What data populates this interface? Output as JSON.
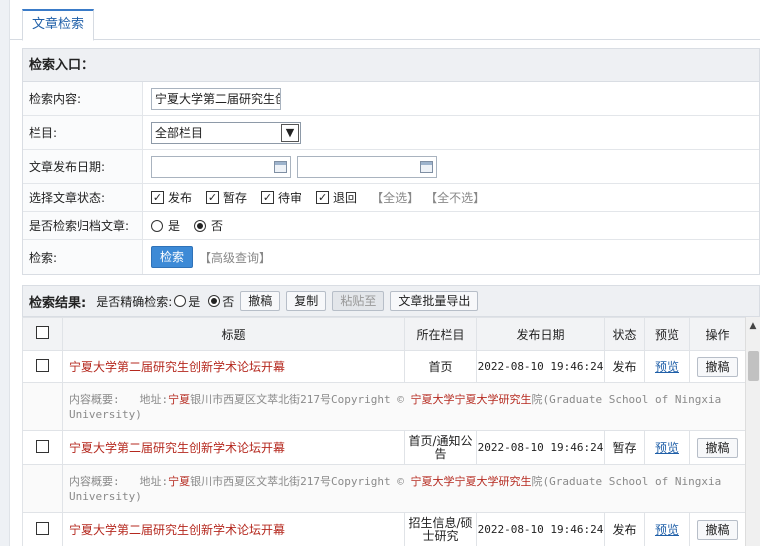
{
  "tab": {
    "label": "文章检索"
  },
  "search": {
    "header": "检索入口：",
    "content_label": "检索内容:",
    "content_value": "宁夏大学第二届研究生创",
    "column_label": "栏目:",
    "column_value": "全部栏目",
    "date_label": "文章发布日期:",
    "status_label": "选择文章状态:",
    "status_options": [
      "发布",
      "暂存",
      "待审",
      "退回"
    ],
    "select_all": "【全选】",
    "select_none": "【全不选】",
    "archive_label": "是否检索归档文章:",
    "archive_yes": "是",
    "archive_no": "否",
    "search_label": "检索:",
    "search_button": "检索",
    "advanced_link": "【高级查询】"
  },
  "results": {
    "header": "检索结果:",
    "exact_label": "是否精确检索:",
    "exact_yes": "是",
    "exact_no": "否",
    "withdraw": "撤稿",
    "copy": "复制",
    "paste": "粘贴至",
    "export": "文章批量导出",
    "columns": {
      "title": "标题",
      "column": "所在栏目",
      "date": "发布日期",
      "status": "状态",
      "preview": "预览",
      "action": "操作"
    },
    "summary_prefix": "内容概要:",
    "summary_a": "地址:",
    "summary_b": "宁夏",
    "summary_c": "银川市西夏区文萃北街217号Copyright © ",
    "summary_d": "宁夏大学宁夏大学研究生",
    "summary_e": "院(Graduate School of Ningxia University)",
    "rows": [
      {
        "title": "宁夏大学第二届研究生创新学术论坛开幕",
        "column": "首页",
        "date": "2022-08-10 19:46:24",
        "status": "发布",
        "preview": "预览",
        "action": "撤稿"
      },
      {
        "title": "宁夏大学第二届研究生创新学术论坛开幕",
        "column": "首页/通知公告",
        "date": "2022-08-10 19:46:24",
        "status": "暂存",
        "preview": "预览",
        "action": "撤稿"
      },
      {
        "title": "宁夏大学第二届研究生创新学术论坛开幕",
        "column": "招生信息/硕士研究",
        "date": "2022-08-10 19:46:24",
        "status": "发布",
        "preview": "预览",
        "action": "撤稿"
      }
    ]
  }
}
